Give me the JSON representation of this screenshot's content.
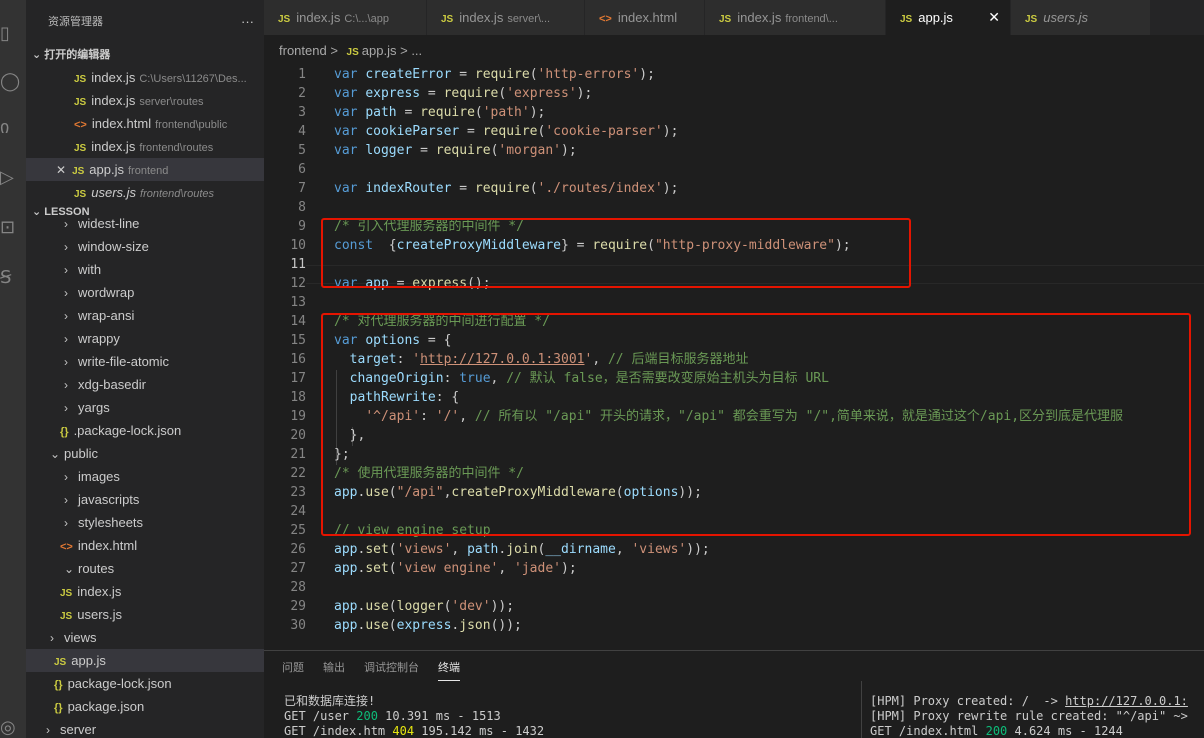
{
  "activity_icons": [
    "files-icon",
    "search-icon",
    "source-control-icon",
    "run-debug-icon",
    "extensions-icon",
    "remote-icon",
    "account-icon"
  ],
  "sidebar": {
    "title": "资源管理器",
    "more": "···",
    "open_editors_title": "打开的编辑器",
    "open_editors": [
      {
        "icon": "JS",
        "name": "index.js",
        "path": "C:\\Users\\11267\\Des...",
        "close": ""
      },
      {
        "icon": "JS",
        "name": "index.js",
        "path": "server\\routes",
        "close": ""
      },
      {
        "icon": "<>",
        "name": "index.html",
        "path": "frontend\\public",
        "close": ""
      },
      {
        "icon": "JS",
        "name": "index.js",
        "path": "frontend\\routes",
        "close": ""
      },
      {
        "icon": "JS",
        "name": "app.js",
        "path": "frontend",
        "close": "✕"
      },
      {
        "icon": "JS",
        "name": "users.js",
        "path": "frontend\\routes",
        "close": ""
      }
    ],
    "lesson_title": "LESSON",
    "tree": [
      {
        "chev": "›",
        "name": "widest-line"
      },
      {
        "chev": "›",
        "name": "window-size"
      },
      {
        "chev": "›",
        "name": "with"
      },
      {
        "chev": "›",
        "name": "wordwrap"
      },
      {
        "chev": "›",
        "name": "wrap-ansi"
      },
      {
        "chev": "›",
        "name": "wrappy"
      },
      {
        "chev": "›",
        "name": "write-file-atomic"
      },
      {
        "chev": "›",
        "name": "xdg-basedir"
      },
      {
        "chev": "›",
        "name": "yargs"
      },
      {
        "icon": "{}",
        "name": ".package-lock.json"
      },
      {
        "chev": "⌄",
        "name": "public"
      },
      {
        "chev": "›",
        "name": "images"
      },
      {
        "chev": "›",
        "name": "javascripts"
      },
      {
        "chev": "›",
        "name": "stylesheets"
      },
      {
        "icon": "<>",
        "name": "index.html"
      },
      {
        "chev": "⌄",
        "name": "routes"
      },
      {
        "icon": "JS",
        "name": "index.js"
      },
      {
        "icon": "JS",
        "name": "users.js"
      },
      {
        "chev": "›",
        "name": "views"
      },
      {
        "icon": "JS",
        "name": "app.js"
      },
      {
        "icon": "{}",
        "name": "package-lock.json"
      },
      {
        "icon": "{}",
        "name": "package.json"
      },
      {
        "chev": "›",
        "name": "server"
      }
    ]
  },
  "tabs": [
    {
      "icon": "JS",
      "name": "index.js",
      "sub": "C:\\...\\app"
    },
    {
      "icon": "JS",
      "name": "index.js",
      "sub": "server\\..."
    },
    {
      "icon": "<>",
      "name": "index.html",
      "sub": ""
    },
    {
      "icon": "JS",
      "name": "index.js",
      "sub": "frontend\\..."
    },
    {
      "icon": "JS",
      "name": "app.js",
      "sub": "",
      "close": "✕"
    },
    {
      "icon": "JS",
      "name": "users.js",
      "sub": ""
    }
  ],
  "breadcrumb": {
    "folder": "frontend",
    "sep": ">",
    "icon": "JS",
    "file": "app.js",
    "tail": "> ..."
  },
  "code_lines": [
    {
      "n": "1",
      "text": "var createError = require('http-errors');"
    },
    {
      "n": "2",
      "text": "var express = require('express');"
    },
    {
      "n": "3",
      "text": "var path = require('path');"
    },
    {
      "n": "4",
      "text": "var cookieParser = require('cookie-parser');"
    },
    {
      "n": "5",
      "text": "var logger = require('morgan');"
    },
    {
      "n": "6",
      "text": ""
    },
    {
      "n": "7",
      "text": "var indexRouter = require('./routes/index');"
    },
    {
      "n": "8",
      "text": ""
    },
    {
      "n": "9",
      "text": "/* 引入代理服务器的中间件 */"
    },
    {
      "n": "10",
      "text": "const  {createProxyMiddleware} = require(\"http-proxy-middleware\");"
    },
    {
      "n": "11",
      "text": ""
    },
    {
      "n": "12",
      "text": "var app = express();"
    },
    {
      "n": "13",
      "text": ""
    },
    {
      "n": "14",
      "text": "/* 对代理服务器的中间进行配置 */"
    },
    {
      "n": "15",
      "text": "var options = {"
    },
    {
      "n": "16",
      "text": "  target: 'http://127.0.0.1:3001', // 后端目标服务器地址"
    },
    {
      "n": "17",
      "text": "  changeOrigin: true, // 默认 false，是否需要改变原始主机头为目标 URL"
    },
    {
      "n": "18",
      "text": "  pathRewrite: {"
    },
    {
      "n": "19",
      "text": "    '^/api': '/', // 所有以 \"/api\" 开头的请求，\"/api\" 都会重写为 \"/\",简单来说，就是通过这个/api,区分到底是代理服"
    },
    {
      "n": "20",
      "text": "  },"
    },
    {
      "n": "21",
      "text": "};"
    },
    {
      "n": "22",
      "text": "/* 使用代理服务器的中间件 */"
    },
    {
      "n": "23",
      "text": "app.use(\"/api\",createProxyMiddleware(options));"
    },
    {
      "n": "24",
      "text": ""
    },
    {
      "n": "25",
      "text": "// view engine setup"
    },
    {
      "n": "26",
      "text": "app.set('views', path.join(__dirname, 'views'));"
    },
    {
      "n": "27",
      "text": "app.set('view engine', 'jade');"
    },
    {
      "n": "28",
      "text": ""
    },
    {
      "n": "29",
      "text": "app.use(logger('dev'));"
    },
    {
      "n": "30",
      "text": "app.use(express.json());"
    }
  ],
  "panel": {
    "tabs": [
      "问题",
      "输出",
      "调试控制台",
      "终端"
    ],
    "active_tab": "终端",
    "left_lines": [
      {
        "a": "已和数据库连接!",
        "b": "",
        "c": ""
      },
      {
        "a": "GET /user ",
        "b": "200",
        "c": " 10.391 ms - 1513"
      },
      {
        "a": "GET /index.htm ",
        "b": "404",
        "c": " 195.142 ms - 1432"
      }
    ],
    "right_lines": [
      {
        "a": "[HPM] Proxy created: /  -> ",
        "b": "http://127.0.0.1:",
        "c": ""
      },
      {
        "a": "[HPM] Proxy rewrite rule created: \"^/api\" ~>",
        "b": "",
        "c": ""
      },
      {
        "a": "GET /index.html ",
        "b": "200",
        "c": " 4.624 ms - 1244"
      }
    ]
  },
  "colors": {
    "highlight_box": "#e51400",
    "keyword": "#569cd6",
    "string": "#ce9178",
    "comment": "#6a9955"
  }
}
